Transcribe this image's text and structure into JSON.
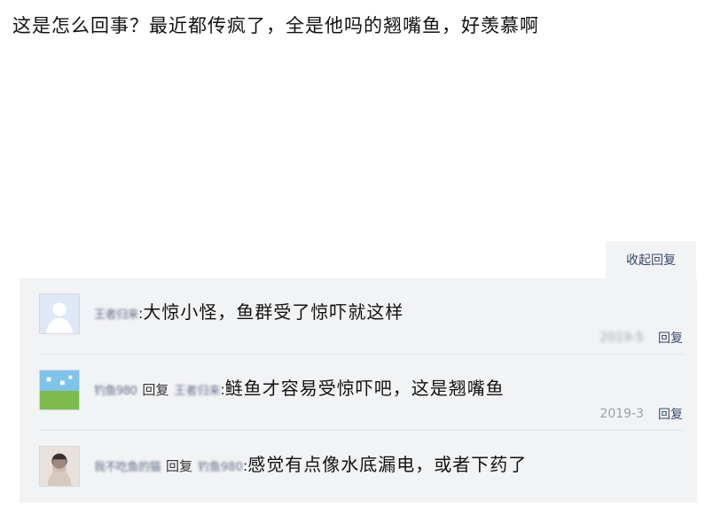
{
  "post": {
    "question": "这是怎么回事？最近都传疯了，全是他吗的翘嘴鱼，好羡慕啊"
  },
  "replies_panel": {
    "collapse_label": "收起回复",
    "items": [
      {
        "avatar_icon": "default-user-avatar",
        "username": "王者归来 ",
        "reply_word": "",
        "target_user": "",
        "text": "大惊小怪，鱼群受了惊吓就这样",
        "date": "2019-5",
        "reply_label": "回复"
      },
      {
        "avatar_icon": "landscape-avatar",
        "username": "钓鱼980",
        "reply_word": "回复",
        "target_user": "王者归来 ",
        "text": "鲢鱼才容易受惊吓吧，这是翘嘴鱼",
        "date": "2019-3",
        "reply_label": "回复"
      },
      {
        "avatar_icon": "person-photo-avatar",
        "username": "我不吃鱼的猫",
        "reply_word": "回复",
        "target_user": "钓鱼980",
        "text": "感觉有点像水底漏电，或者下药了",
        "date": "",
        "reply_label": ""
      }
    ]
  },
  "colors": {
    "panel_bg": "#f2f3f5",
    "link_blue": "#3b4b6b",
    "meta_gray": "#9aa0a8"
  }
}
